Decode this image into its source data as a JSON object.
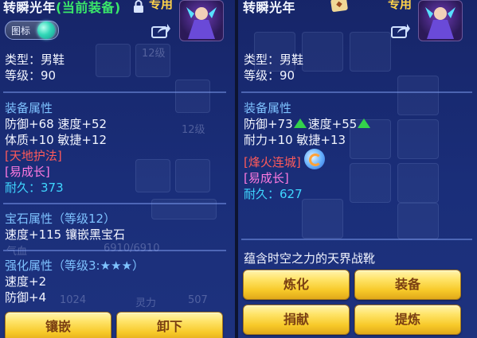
{
  "left": {
    "item_name": "转瞬光年",
    "equipped_tag": "(当前装备)",
    "exclusive": "专用",
    "toggle_label": "图标",
    "type_line": "类型：男鞋",
    "level_line": "等级：90",
    "equip_attr_header": "装备属性",
    "stats_line1": "防御+68 速度+52",
    "stats_line2": "体质+10 敏捷+12",
    "special_skill": "[天地护法]",
    "special_effect": "[易成长]",
    "durability": "耐久：373",
    "gem_header": "宝石属性（等级12）",
    "gem_line": "速度+115 镶嵌黑宝石",
    "forge_header": "强化属性（等级3:★★★）",
    "forge_line1": "速度+2",
    "forge_line2": "防御+4",
    "btn_inlay": "镶嵌",
    "btn_unequip": "卸下"
  },
  "right": {
    "item_name": "转瞬光年",
    "exclusive": "专用",
    "type_line": "类型：男鞋",
    "level_line": "等级：90",
    "equip_attr_header": "装备属性",
    "stats_def": "防御+73",
    "stats_spd": "速度+55",
    "stats_line2": "耐力+10 敏捷+13",
    "special_skill": "[烽火连城]",
    "special_effect": "[易成长]",
    "durability": "耐久：627",
    "suit_text": "蕴含时空之力的天界战靴",
    "btn_refine": "炼化",
    "btn_equip": "装备",
    "btn_donate": "捐献",
    "btn_extract": "提炼"
  },
  "background": {
    "level_tag_1": "12级",
    "level_tag_2": "12级",
    "hp_label": "气血",
    "hp_value": "6910/6910",
    "text_1": "1024",
    "text_2": "灵力",
    "text_3": "507"
  },
  "colors": {
    "panel_bg": "#1a3080",
    "equipped_tag": "#3ae86a",
    "exclusive": "#ffd34a",
    "section_header": "#7ec2ff",
    "special_skill": "#ff5a5a",
    "special_effect": "#ff7ae0",
    "durability": "#3fd6ff",
    "upgrade_arrow": "#33d24b",
    "button_fill": "#f7c928",
    "button_text": "#7a3f12"
  },
  "icons": [
    "lock-icon",
    "share-icon",
    "character-portrait",
    "seal-badge-icon",
    "upgrade-arrow-icon",
    "skill-orb-icon",
    "toggle-knob"
  ]
}
